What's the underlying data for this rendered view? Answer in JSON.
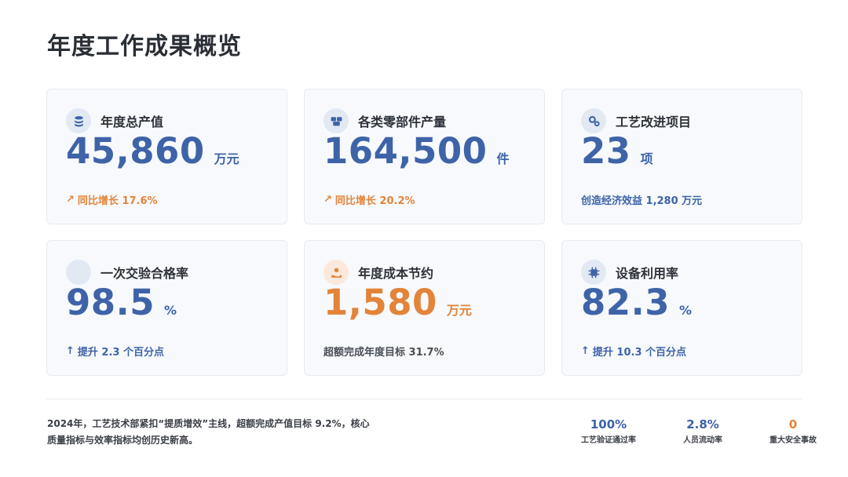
{
  "page": {
    "title": "年度工作成果概览"
  },
  "cards": [
    {
      "label": "年度总产值",
      "value": "45,860",
      "unit": "万元",
      "footer_arrow": "↗",
      "footer": "同比增长 17.6%",
      "icon": "coins-icon"
    },
    {
      "label": "各类零部件产量",
      "value": "164,500",
      "unit": "件",
      "footer_arrow": "↗",
      "footer": "同比增长 20.2%",
      "icon": "boxes-icon"
    },
    {
      "label": "工艺改进项目",
      "value": "23",
      "unit": "项",
      "footer_arrow": "",
      "footer": "创造经济效益 1,280 万元",
      "icon": "gears-icon"
    },
    {
      "label": "一次交验合格率",
      "value": "98.5",
      "unit": "%",
      "footer_arrow": "↑",
      "footer": "提升 2.3 个百分点",
      "icon": "blank-circle-icon"
    },
    {
      "label": "年度成本节约",
      "value": "1,580",
      "unit": "万元",
      "footer_arrow": "",
      "footer": "超额完成年度目标 31.7%",
      "icon": "hand-coin-icon"
    },
    {
      "label": "设备利用率",
      "value": "82.3",
      "unit": "%",
      "footer_arrow": "↑",
      "footer": "提升 10.3 个百分点",
      "icon": "chip-icon"
    }
  ],
  "summary": {
    "line1": "2024年，工艺技术部紧扣“提质增效”主线，超额完成产值目标 9.2%，核心",
    "line2": "质量指标与效率指标均创历史新高。"
  },
  "stats": [
    {
      "value": "100%",
      "label": "工艺验证通过率"
    },
    {
      "value": "2.8%",
      "label": "人员流动率"
    },
    {
      "value": "0",
      "label": "重大安全事故"
    }
  ],
  "colors": {
    "accent_blue": "#3e63a8",
    "accent_orange": "#e38439",
    "card_bg": "#f7f9fc"
  }
}
